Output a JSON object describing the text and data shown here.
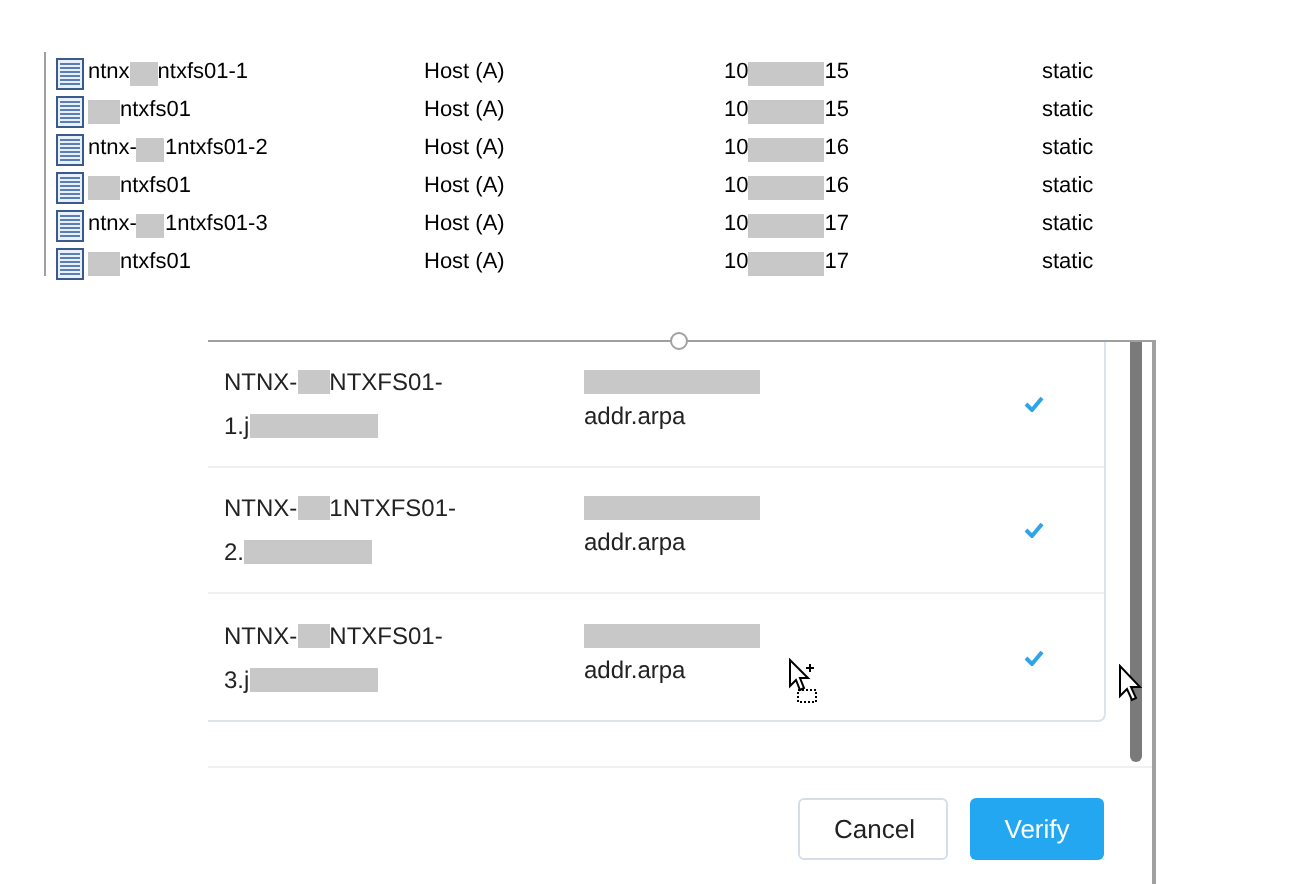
{
  "records": [
    {
      "name_parts": [
        "ntnx",
        "ntxfs01-1"
      ],
      "type": "Host (A)",
      "data_parts": [
        "10",
        "15"
      ],
      "timestamp": "static"
    },
    {
      "name_parts": [
        "ntxfs01"
      ],
      "type": "Host (A)",
      "data_parts": [
        "10",
        "15"
      ],
      "timestamp": "static"
    },
    {
      "name_parts": [
        "ntnx-",
        "1ntxfs01-2"
      ],
      "type": "Host (A)",
      "data_parts": [
        "10",
        "16"
      ],
      "timestamp": "static"
    },
    {
      "name_parts": [
        "ntxfs01"
      ],
      "type": "Host (A)",
      "data_parts": [
        "10",
        "16"
      ],
      "timestamp": "static"
    },
    {
      "name_parts": [
        "ntnx-",
        "1ntxfs01-3"
      ],
      "type": "Host (A)",
      "data_parts": [
        "10",
        "17"
      ],
      "timestamp": "static"
    },
    {
      "name_parts": [
        "ntxfs01"
      ],
      "type": "Host (A)",
      "data_parts": [
        "10",
        "17"
      ],
      "timestamp": "static"
    }
  ],
  "dialog": {
    "entries": [
      {
        "host_parts": [
          "NTNX-",
          "NTXFS01-"
        ],
        "host_line2": "1.j",
        "ptr": "addr.arpa",
        "verified": true
      },
      {
        "host_parts": [
          "NTNX-",
          "1NTXFS01-"
        ],
        "host_line2": "2.",
        "ptr": "addr.arpa",
        "verified": true
      },
      {
        "host_parts": [
          "NTNX-",
          "NTXFS01-"
        ],
        "host_line2": "3.j",
        "ptr": "addr.arpa",
        "verified": true
      }
    ],
    "buttons": [
      {
        "label": "Cancel",
        "kind": "secondary"
      },
      {
        "label": "Verify",
        "kind": "primary"
      }
    ]
  }
}
